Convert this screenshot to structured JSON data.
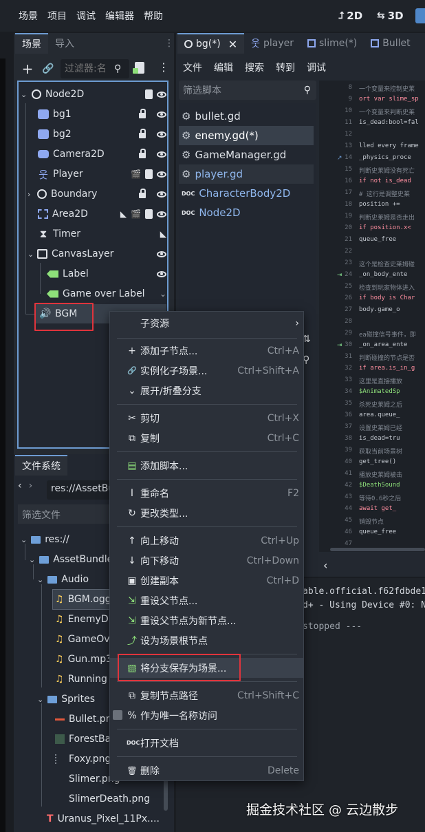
{
  "menubar": {
    "items": [
      "场景",
      "项目",
      "调试",
      "编辑器",
      "帮助"
    ],
    "mode_2d": "2D",
    "mode_3d": "3D"
  },
  "scene_dock": {
    "tabs": [
      "场景",
      "导入"
    ],
    "filter_placeholder": "过滤器:名",
    "nodes": [
      {
        "label": "Node2D",
        "icon": "node-circle-icon"
      },
      {
        "label": "bg1",
        "icon": "sprite-icon"
      },
      {
        "label": "bg2",
        "icon": "sprite-icon"
      },
      {
        "label": "Camera2D",
        "icon": "camera-icon"
      },
      {
        "label": "Player",
        "icon": "character-icon"
      },
      {
        "label": "Boundary",
        "icon": "node-circle-icon"
      },
      {
        "label": "Area2D",
        "icon": "area-icon"
      },
      {
        "label": "Timer",
        "icon": "timer-icon"
      },
      {
        "label": "CanvasLayer",
        "icon": "canvas-layer-icon"
      },
      {
        "label": "Label",
        "icon": "label-icon"
      },
      {
        "label": "Game over Label",
        "icon": "label-icon"
      },
      {
        "label": "BGM",
        "icon": "speaker-icon"
      }
    ]
  },
  "filesystem": {
    "tab": "文件系统",
    "path": "res://AssetBu",
    "filter_placeholder": "筛选文件",
    "items": [
      {
        "label": "res://",
        "type": "folder"
      },
      {
        "label": "AssetBundle",
        "type": "folder"
      },
      {
        "label": "Audio",
        "type": "folder"
      },
      {
        "label": "BGM.ogg",
        "type": "audio"
      },
      {
        "label": "EnemyD",
        "type": "audio"
      },
      {
        "label": "GameOv",
        "type": "audio"
      },
      {
        "label": "Gun.mp3",
        "type": "audio"
      },
      {
        "label": "Running",
        "type": "audio"
      },
      {
        "label": "Sprites",
        "type": "folder"
      },
      {
        "label": "Bullet.pn",
        "type": "image"
      },
      {
        "label": "ForestBa",
        "type": "image"
      },
      {
        "label": "Foxy.png",
        "type": "image"
      },
      {
        "label": "Slimer.png",
        "type": "image"
      },
      {
        "label": "SlimerDeath.png",
        "type": "image"
      },
      {
        "label": "Uranus_Pixel_11Px....",
        "type": "font"
      }
    ]
  },
  "editor_tabs": [
    "bg(*)",
    "player",
    "slime(*)",
    "Bullet"
  ],
  "script_menu": [
    "文件",
    "编辑",
    "搜索",
    "转到",
    "调试"
  ],
  "script_filter_placeholder": "筛选脚本",
  "scripts": [
    {
      "label": "bullet.gd",
      "color": "#dde1e6"
    },
    {
      "label": "enemy.gd(*)",
      "color": "#ffffff"
    },
    {
      "label": "GameManager.gd",
      "color": "#dde1e6"
    },
    {
      "label": "player.gd",
      "color": "#8fb6ec"
    },
    {
      "label": "CharacterBody2D",
      "color": "#8fb6ec"
    },
    {
      "label": "Node2D",
      "color": "#8fb6ec"
    }
  ],
  "code_lines": [
    {
      "n": "8",
      "t": "一个变量来控制史莱"
    },
    {
      "n": "9",
      "t": "ort var slime_sp"
    },
    {
      "n": "10",
      "t": "一个变量来判断史莱"
    },
    {
      "n": "11",
      "t": "is_dead:bool=fal"
    },
    {
      "n": "12",
      "t": ""
    },
    {
      "n": "13",
      "t": "lled every frame"
    },
    {
      "n": "14",
      "t": "_physics_proce"
    },
    {
      "n": "15",
      "t": "判断史莱姆没有死亡"
    },
    {
      "n": "16",
      "t": "if not is_dead"
    },
    {
      "n": "17",
      "t": "#  这行是调整史莱"
    },
    {
      "n": "18",
      "t": "  position +="
    },
    {
      "n": "19",
      "t": "判断史莱姆是否走出"
    },
    {
      "n": "20",
      "t": "if position.x<"
    },
    {
      "n": "21",
      "t": "  queue_free"
    },
    {
      "n": "22",
      "t": ""
    },
    {
      "n": "23",
      "t": "这个是检查史莱姆碰"
    },
    {
      "n": "24",
      "t": "_on_body_ente"
    },
    {
      "n": "25",
      "t": "检查到玩家物体进入"
    },
    {
      "n": "26",
      "t": "if body is Char"
    },
    {
      "n": "27",
      "t": "  body.game_o"
    },
    {
      "n": "28",
      "t": ""
    },
    {
      "n": "29",
      "t": "ea碰撞信号事件，即"
    },
    {
      "n": "30",
      "t": "_on_area_ente"
    },
    {
      "n": "31",
      "t": "判断碰撞的节点是否"
    },
    {
      "n": "32",
      "t": "if area.is_in_g"
    },
    {
      "n": "33",
      "t": "  这里是直接播放"
    },
    {
      "n": "34",
      "t": "  $AnimatedSp"
    },
    {
      "n": "35",
      "t": "  杀死史莱姆之后"
    },
    {
      "n": "36",
      "t": "  area.queue_"
    },
    {
      "n": "37",
      "t": "  设置史莱姆已经"
    },
    {
      "n": "38",
      "t": "  is_dead=tru"
    },
    {
      "n": "39",
      "t": "  获取当前场景树"
    },
    {
      "n": "40",
      "t": "  get_tree()"
    },
    {
      "n": "41",
      "t": "  播放史莱姆被击"
    },
    {
      "n": "42",
      "t": "  $DeathSound"
    },
    {
      "n": "43",
      "t": "  等待0.6秒之后"
    },
    {
      "n": "44",
      "t": "  await  get_"
    },
    {
      "n": "45",
      "t": "  销毁节点"
    },
    {
      "n": "46",
      "t": "  queue_free"
    },
    {
      "n": "47",
      "t": ""
    }
  ],
  "output": {
    "line1": "able.official.f62fdbde1",
    "line2": "d+ - Using Device #0: N",
    "line3": "stopped ---"
  },
  "context_menu": {
    "items": [
      {
        "label": "子资源",
        "shortcut": "",
        "icon": "",
        "arrow": "submenu-arrow-icon"
      },
      {
        "label": "添加子节点...",
        "shortcut": "Ctrl+A",
        "icon": "+"
      },
      {
        "label": "实例化子场景...",
        "shortcut": "Ctrl+Shift+A",
        "icon": "🔗"
      },
      {
        "label": "展开/折叠分支",
        "shortcut": "",
        "icon": "⌄"
      },
      {
        "label": "剪切",
        "shortcut": "Ctrl+X",
        "icon": "✂"
      },
      {
        "label": "复制",
        "shortcut": "Ctrl+C",
        "icon": "⧉"
      },
      {
        "label": "添加脚本...",
        "shortcut": "",
        "icon": "▤"
      },
      {
        "label": "重命名",
        "shortcut": "F2",
        "icon": "I"
      },
      {
        "label": "更改类型...",
        "shortcut": "",
        "icon": "↻"
      },
      {
        "label": "向上移动",
        "shortcut": "Ctrl+Up",
        "icon": "↑"
      },
      {
        "label": "向下移动",
        "shortcut": "Ctrl+Down",
        "icon": "↓"
      },
      {
        "label": "创建副本",
        "shortcut": "Ctrl+D",
        "icon": "▣"
      },
      {
        "label": "重设父节点...",
        "shortcut": "",
        "icon": "⇲"
      },
      {
        "label": "重设父节点为新节点...",
        "shortcut": "",
        "icon": "⇲"
      },
      {
        "label": "设为场景根节点",
        "shortcut": "",
        "icon": "⤴"
      },
      {
        "label": "将分支保存为场景...",
        "shortcut": "",
        "icon": "▧"
      },
      {
        "label": "复制节点路径",
        "shortcut": "Ctrl+Shift+C",
        "icon": "⧉"
      },
      {
        "label": "作为唯一名称访问",
        "shortcut": "",
        "icon": "%"
      },
      {
        "label": "打开文档",
        "shortcut": "",
        "icon": "▤"
      },
      {
        "label": "删除",
        "shortcut": "Delete",
        "icon": "🗑"
      }
    ]
  },
  "watermark": "掘金技术社区 @ 云边散步",
  "colors": {
    "accent": "#6d9bd1",
    "highlight_box": "#e0343c"
  }
}
